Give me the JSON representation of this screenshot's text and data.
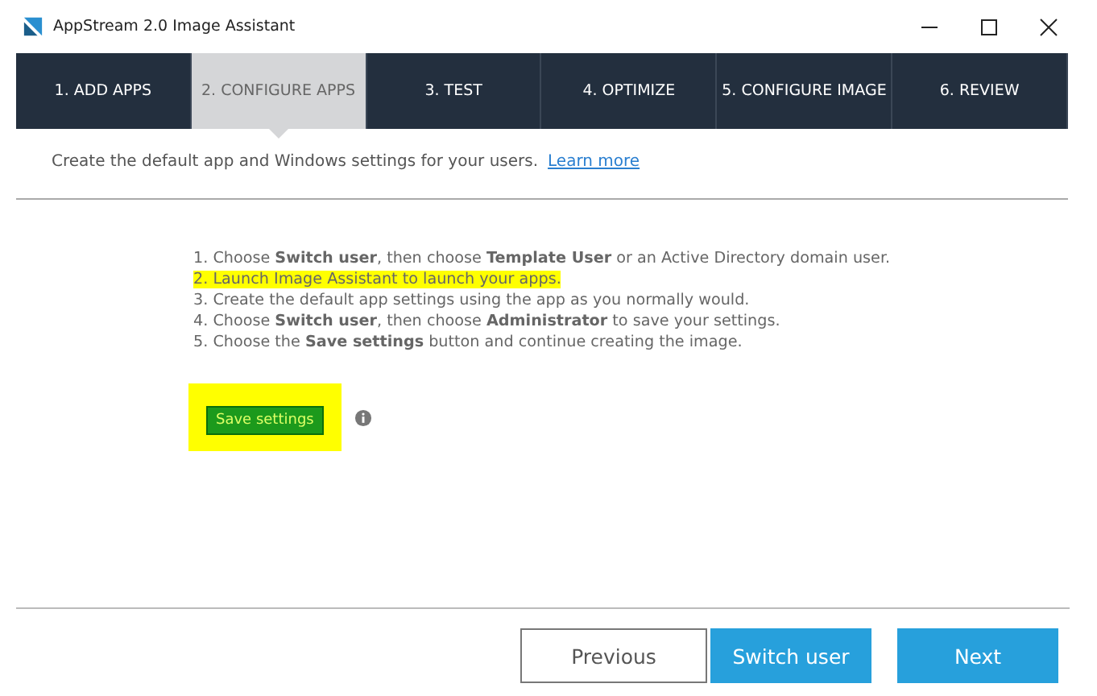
{
  "window": {
    "title": "AppStream 2.0 Image Assistant"
  },
  "tabs": [
    {
      "label": "1. ADD APPS",
      "selected": false
    },
    {
      "label": "2. CONFIGURE APPS",
      "selected": true
    },
    {
      "label": "3. TEST",
      "selected": false
    },
    {
      "label": "4. OPTIMIZE",
      "selected": false
    },
    {
      "label": "5. CONFIGURE IMAGE",
      "selected": false
    },
    {
      "label": "6. REVIEW",
      "selected": false
    }
  ],
  "intro": {
    "text": "Create the default app and Windows settings for your users.",
    "link": "Learn more"
  },
  "steps": [
    {
      "text": "1. Choose **Switch user**, then choose **Template User** or an Active Directory domain user.",
      "highlighted": false
    },
    {
      "text": "2. Launch Image Assistant to launch your apps.",
      "highlighted": true
    },
    {
      "text": "3. Create the default app settings using the app as you normally would.",
      "highlighted": false
    },
    {
      "text": "4. Choose **Switch user**, then choose **Administrator** to save your settings.",
      "highlighted": false
    },
    {
      "text": "5. Choose the **Save settings** button and continue creating the image.",
      "highlighted": false
    }
  ],
  "save_button": {
    "label": "Save settings",
    "highlighted": true
  },
  "buttons": [
    {
      "label": "Previous",
      "kind": "secondary"
    },
    {
      "label": "Switch user",
      "kind": "primary"
    },
    {
      "label": "Next",
      "kind": "primary"
    }
  ]
}
